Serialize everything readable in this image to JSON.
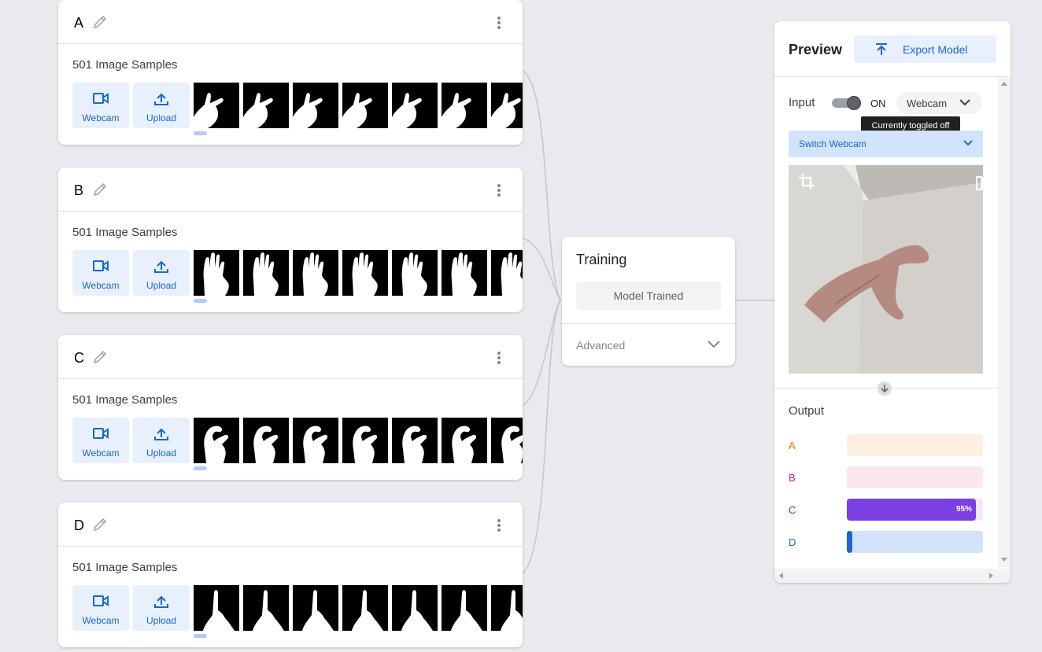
{
  "classes": [
    {
      "name": "A",
      "sample_count_label": "501 Image Samples",
      "webcam_label": "Webcam",
      "upload_label": "Upload",
      "gesture": "gesture-a"
    },
    {
      "name": "B",
      "sample_count_label": "501 Image Samples",
      "webcam_label": "Webcam",
      "upload_label": "Upload",
      "gesture": "gesture-b"
    },
    {
      "name": "C",
      "sample_count_label": "501 Image Samples",
      "webcam_label": "Webcam",
      "upload_label": "Upload",
      "gesture": "gesture-c"
    },
    {
      "name": "D",
      "sample_count_label": "501 Image Samples",
      "webcam_label": "Webcam",
      "upload_label": "Upload",
      "gesture": "gesture-d"
    }
  ],
  "training": {
    "title": "Training",
    "status_button": "Model Trained",
    "advanced_label": "Advanced"
  },
  "preview": {
    "title": "Preview",
    "export_label": "Export Model",
    "input_label": "Input",
    "toggle_state": "ON",
    "source_select": "Webcam",
    "tooltip": "Currently toggled off",
    "switch_webcam_label": "Switch Webcam",
    "output_title": "Output",
    "outputs": [
      {
        "label": "A",
        "value": 0.0,
        "color": "#e37400",
        "track": "#feefe3",
        "fill": "#e37400",
        "pct_text": ""
      },
      {
        "label": "B",
        "value": 0.0,
        "color": "#d01884",
        "track": "#fde7ef",
        "fill": "#d01884",
        "pct_text": ""
      },
      {
        "label": "C",
        "value": 0.95,
        "color": "#7627bb",
        "track": "#f1e8fb",
        "fill": "#7b3fe4",
        "pct_text": "95%"
      },
      {
        "label": "D",
        "value": 0.04,
        "color": "#1967d2",
        "track": "#d2e3fc",
        "fill": "#1967d2",
        "pct_text": ""
      }
    ]
  },
  "colors": {
    "accent": "#1967d2",
    "tile_bg": "#e8f0fe",
    "page_bg": "#e8eaed"
  }
}
